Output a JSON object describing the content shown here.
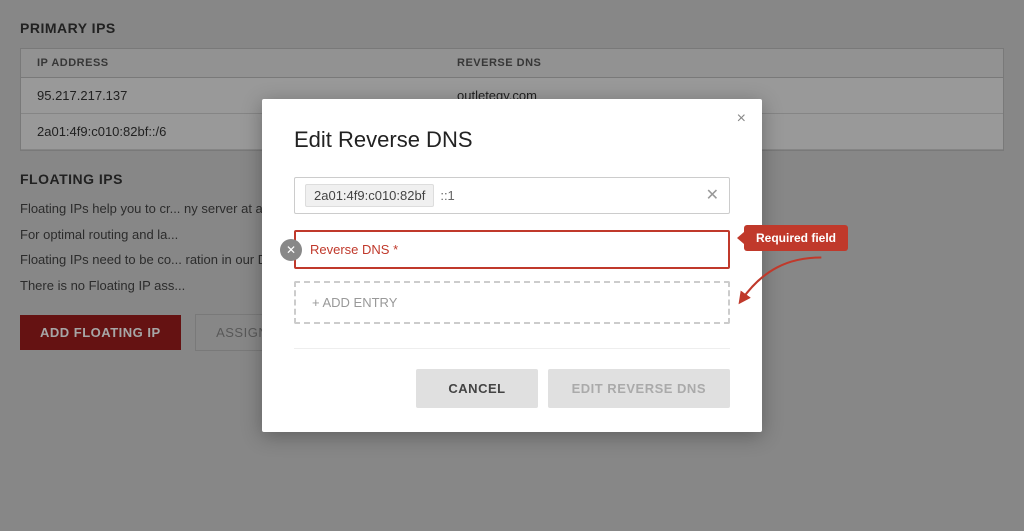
{
  "page": {
    "background_color": "#d0d0d0"
  },
  "primary_ips": {
    "section_title": "PRIMARY IPS",
    "table_headers": [
      "IP ADDRESS",
      "REVERSE DNS"
    ],
    "rows": [
      {
        "ip": "95.217.217.137",
        "reverse_dns": "outletegy.com"
      },
      {
        "ip": "2a01:4f9:c010:82bf::/6",
        "reverse_dns": ""
      }
    ]
  },
  "floating_ips": {
    "section_title": "FLOATING IPS",
    "description_lines": [
      "Floating IPs help you to cr... ny server at any time in any location.",
      "For optimal routing and la...",
      "Floating IPs need to be co... ration in our Docs.",
      "There is no Floating IP ass..."
    ],
    "add_button": "ADD FLOATING IP",
    "assign_button": "ASSIGN FLOATING IP"
  },
  "modal": {
    "title": "Edit Reverse DNS",
    "close_label": "×",
    "ip_tag": "2a01:4f9:c010:82bf",
    "ip_value": "::1",
    "dns_placeholder": "Reverse DNS *",
    "dns_value": "",
    "required_field_label": "Required field",
    "add_entry_label": "+ ADD ENTRY",
    "cancel_button": "CANCEL",
    "edit_button": "EDIT REVERSE DNS"
  }
}
